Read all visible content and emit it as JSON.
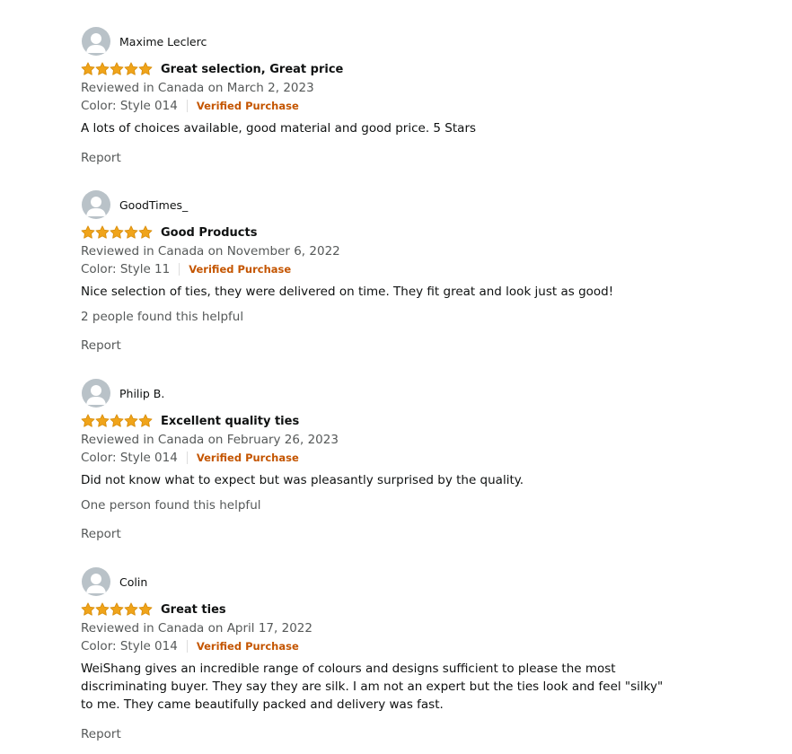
{
  "reviews": [
    {
      "name": "Maxime Leclerc",
      "rating": 5,
      "title": "Great selection, Great price",
      "date": "Reviewed in Canada on March 2, 2023",
      "format": "Color: Style 014",
      "verified": "Verified Purchase",
      "body": "A lots of choices available, good material and good price. 5 Stars",
      "helpful": "",
      "report": "Report"
    },
    {
      "name": "GoodTimes_",
      "rating": 5,
      "title": "Good Products",
      "date": "Reviewed in Canada on November 6, 2022",
      "format": "Color: Style 11",
      "verified": "Verified Purchase",
      "body": "Nice selection of ties, they were delivered on time. They fit great and look just as good!",
      "helpful": "2 people found this helpful",
      "report": "Report"
    },
    {
      "name": "Philip B.",
      "rating": 5,
      "title": "Excellent quality ties",
      "date": "Reviewed in Canada on February 26, 2023",
      "format": "Color: Style 014",
      "verified": "Verified Purchase",
      "body": "Did not know what to expect but was pleasantly surprised by the quality.",
      "helpful": "One person found this helpful",
      "report": "Report"
    },
    {
      "name": "Colin",
      "rating": 5,
      "title": "Great ties",
      "date": "Reviewed in Canada on April 17, 2022",
      "format": "Color: Style 014",
      "verified": "Verified Purchase",
      "body": "WeiShang gives an incredible range of colours and designs sufficient to please the most discriminating buyer. They say they are silk. I am not an expert but the ties look and feel \"silky\" to me. They came beautifully packed and delivery was fast.",
      "helpful": "",
      "report": "Report"
    }
  ],
  "colors": {
    "star": "#f0a41a",
    "verified": "#c45500",
    "secondary_text": "#565959",
    "avatar_bg": "#b9c2c8"
  }
}
